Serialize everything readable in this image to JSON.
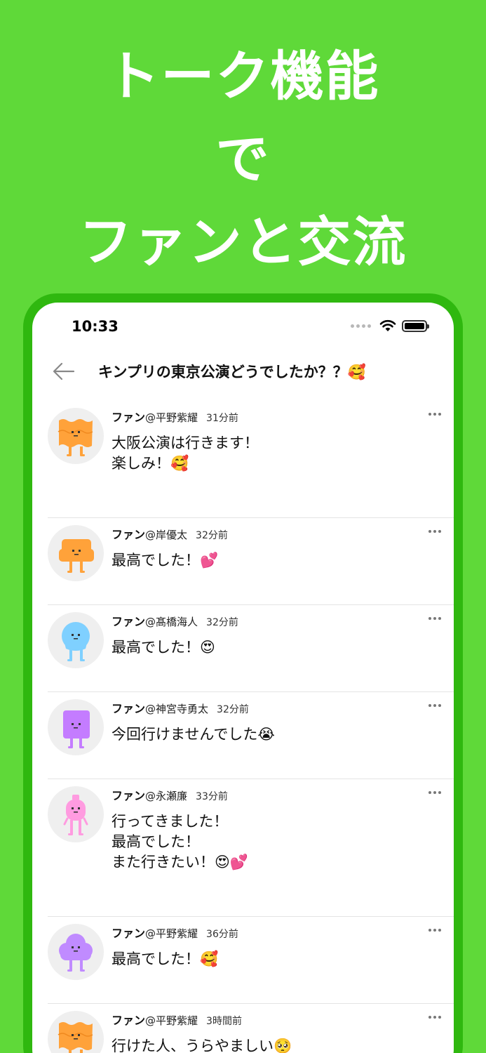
{
  "headline": {
    "line1": "トーク機能",
    "line2": "で",
    "line3": "ファンと交流"
  },
  "status": {
    "time": "10:33"
  },
  "topic": {
    "title": "キンプリの東京公演どうでしたか？？🥰"
  },
  "colors": {
    "background": "#5fd939",
    "frame": "#2fb80f"
  },
  "posts": [
    {
      "label": "ファン",
      "handle": "@平野紫耀",
      "ago": "31分前",
      "lines": [
        "大阪公演は行きます！",
        "楽しみ！🥰"
      ],
      "avatar": "orange-wavy"
    },
    {
      "label": "ファン",
      "handle": "@岸優太",
      "ago": "32分前",
      "lines": [
        "最高でした！💕"
      ],
      "avatar": "orange-square"
    },
    {
      "label": "ファン",
      "handle": "@髙橋海人",
      "ago": "32分前",
      "lines": [
        "最高でした！😍"
      ],
      "avatar": "blue-round"
    },
    {
      "label": "ファン",
      "handle": "@神宮寺勇太",
      "ago": "32分前",
      "lines": [
        "今回行けませんでした😭"
      ],
      "avatar": "purple-square"
    },
    {
      "label": "ファン",
      "handle": "@永瀬廉",
      "ago": "33分前",
      "lines": [
        "行ってきました！",
        "最高でした！",
        "また行きたい！😍💕"
      ],
      "avatar": "pink-bottle"
    },
    {
      "label": "ファン",
      "handle": "@平野紫耀",
      "ago": "36分前",
      "lines": [
        "最高でした！🥰"
      ],
      "avatar": "purple-cloud"
    },
    {
      "label": "ファン",
      "handle": "@平野紫耀",
      "ago": "3時間前",
      "lines": [
        "行けた人、うらやましい🥺"
      ],
      "avatar": "orange-wavy"
    }
  ]
}
